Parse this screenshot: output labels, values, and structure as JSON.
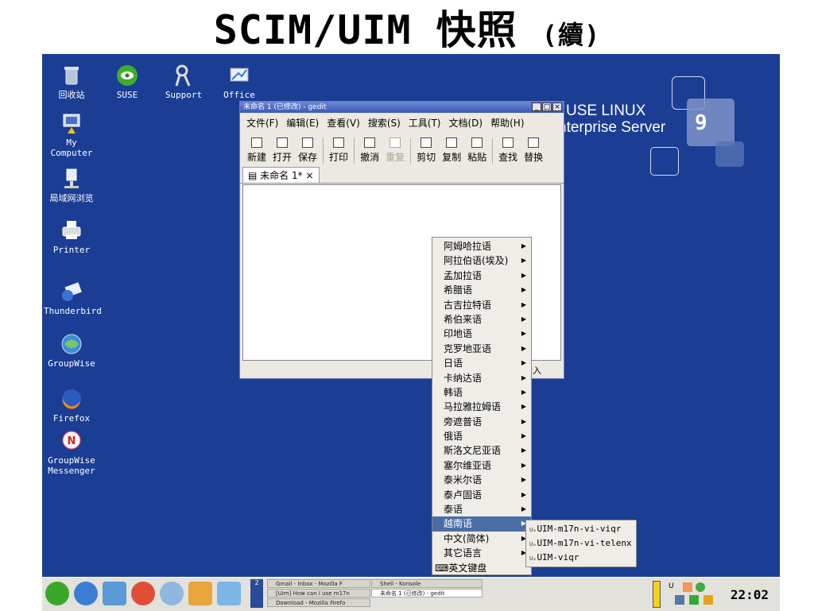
{
  "slide": {
    "title": "SCIM/UIM 快照",
    "subtitle": "(續)"
  },
  "brand": {
    "line1": "USE LINUX",
    "line2": "nterprise Server",
    "version": "9"
  },
  "desktop_icons": [
    {
      "label": "回收站",
      "icon": "trash-icon"
    },
    {
      "label": "SUSE",
      "icon": "suse-icon"
    },
    {
      "label": "Support",
      "icon": "support-icon"
    },
    {
      "label": "Office",
      "icon": "office-icon"
    },
    {
      "label": "My Computer",
      "icon": "computer-icon"
    },
    {
      "label": "局域网浏览",
      "icon": "network-icon"
    },
    {
      "label": "Printer",
      "icon": "printer-icon"
    },
    {
      "label": "Thunderbird",
      "icon": "thunderbird-icon"
    },
    {
      "label": "GroupWise",
      "icon": "groupwise-icon"
    },
    {
      "label": "Firefox",
      "icon": "firefox-icon"
    },
    {
      "label": "GroupWise Messenger",
      "icon": "messenger-icon"
    }
  ],
  "gedit": {
    "title": "未命名 1 (已修改) - gedit",
    "menus": [
      "文件(F)",
      "编辑(E)",
      "查看(V)",
      "搜索(S)",
      "工具(T)",
      "文档(D)",
      "帮助(H)"
    ],
    "toolbar": [
      {
        "label": "新建",
        "disabled": false
      },
      {
        "label": "打开",
        "disabled": false
      },
      {
        "label": "保存",
        "disabled": false
      },
      {
        "label": "打印",
        "disabled": false
      },
      {
        "label": "撤消",
        "disabled": false
      },
      {
        "label": "重复",
        "disabled": true
      },
      {
        "label": "剪切",
        "disabled": false
      },
      {
        "label": "复制",
        "disabled": false
      },
      {
        "label": "粘贴",
        "disabled": false
      },
      {
        "label": "查找",
        "disabled": false
      },
      {
        "label": "替换",
        "disabled": false
      }
    ],
    "tab": "未命名 1*",
    "tab_close": "×",
    "status": "插入"
  },
  "language_menu": {
    "items": [
      "阿姆哈拉语",
      "阿拉伯语(埃及)",
      "孟加拉语",
      "希腊语",
      "古吉拉特语",
      "希伯来语",
      "印地语",
      "克罗地亚语",
      "日语",
      "卡纳达语",
      "韩语",
      "马拉雅拉姆语",
      "旁遮普语",
      "俄语",
      "斯洛文尼亚语",
      "塞尔维亚语",
      "泰米尔语",
      "泰卢固语",
      "泰语",
      "越南语",
      "中文(简体)",
      "其它语言"
    ],
    "highlighted": "越南语",
    "keyboard_item": "英文键盘"
  },
  "vi_submenu": {
    "prefix": "Uₘ",
    "items": [
      "UIM-m17n-vi-viqr",
      "UIM-m17n-vi-telenx",
      "UIM-viqr"
    ]
  },
  "taskbar": {
    "pager_label": "2",
    "tasks": [
      "Gmail - Inbox - Mozilla F",
      "[Uim] How can I use m17n",
      "Download - Mozilla Firefo",
      "Shell - Konsole",
      "未命名 1 (已修改) - gedit"
    ],
    "clock": "22:02"
  },
  "colors": {
    "desktop": "#1b3d94",
    "menu_highlight": "#4a6da5"
  }
}
